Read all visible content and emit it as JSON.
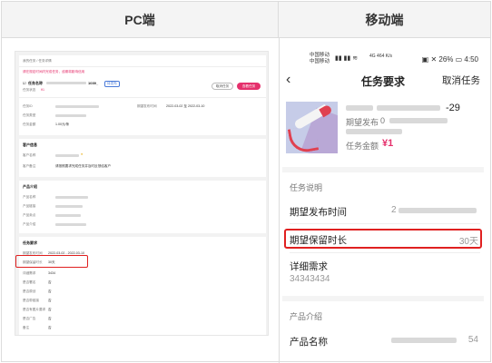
{
  "columns": {
    "pc": "PC端",
    "mobile": "移动端"
  },
  "pc": {
    "breadcrumb": "我的任务 / 任务详情",
    "notice": "请在规定时间内完成任务，逾期将影响信用",
    "task_prefix": "任务名称",
    "task_suffix": "1039_",
    "tag": "待发布",
    "status_label": "任务状态",
    "price": "¥1",
    "btn_cancel": "取消任务",
    "btn_view": "查看任务",
    "info_rows": [
      {
        "label": "任务ID",
        "value": "",
        "extra_label": "期望发布时间",
        "extra_value": "2022-03-02 至 2022-03-10"
      },
      {
        "label": "任务类型",
        "value": ""
      },
      {
        "label": "任务金额",
        "value": "1.00元/条"
      }
    ],
    "customer_title": "客户信息",
    "customer_rows": [
      {
        "label": "客户名称",
        "value": ""
      },
      {
        "label": "客户备注",
        "value": "请按照要求完成任务并及时反馈给客户"
      }
    ],
    "product_title": "产品介绍",
    "product_rows": [
      {
        "label": "产品名称"
      },
      {
        "label": "产品链接"
      },
      {
        "label": "产品卖点"
      },
      {
        "label": "产品介绍"
      }
    ],
    "req_title": "任务要求",
    "req_rows": [
      {
        "label": "期望发布时间",
        "value": "2022-03-02 - 2022-03-10"
      },
      {
        "label": "期望保留时长",
        "value": "30天"
      },
      {
        "label": "详细需求",
        "value": "3434"
      },
      {
        "label": "是否署名",
        "value": "否"
      },
      {
        "label": "是否原创",
        "value": "否"
      },
      {
        "label": "是否带链接",
        "value": "否"
      },
      {
        "label": "是否有图片要求",
        "value": "否"
      },
      {
        "label": "是否广告",
        "value": "否"
      },
      {
        "label": "备注",
        "value": "否"
      }
    ]
  },
  "mobile": {
    "status": {
      "carrier1": "中国移动",
      "carrier2": "中国移动",
      "network": "4G 464 K/s",
      "battery": "26%",
      "time": "4:50"
    },
    "nav": {
      "back": "‹",
      "title": "任务要求",
      "cancel": "取消任务"
    },
    "task": {
      "title_end": "-29",
      "expected_publish": "期望发布",
      "expected_publish_num": "0",
      "amount_label": "任务金额",
      "amount": "¥1"
    },
    "task_desc_title": "任务说明",
    "rows": [
      {
        "label": "期望发布时间",
        "value": "2"
      },
      {
        "label": "期望保留时长",
        "value": "30天"
      }
    ],
    "detail_title": "详细需求",
    "detail_value": "34343434",
    "product_title": "产品介绍",
    "product_name_label": "产品名称",
    "product_name_value": "54"
  },
  "colors": {
    "accent": "#e5306c",
    "highlight": "#e02020"
  }
}
